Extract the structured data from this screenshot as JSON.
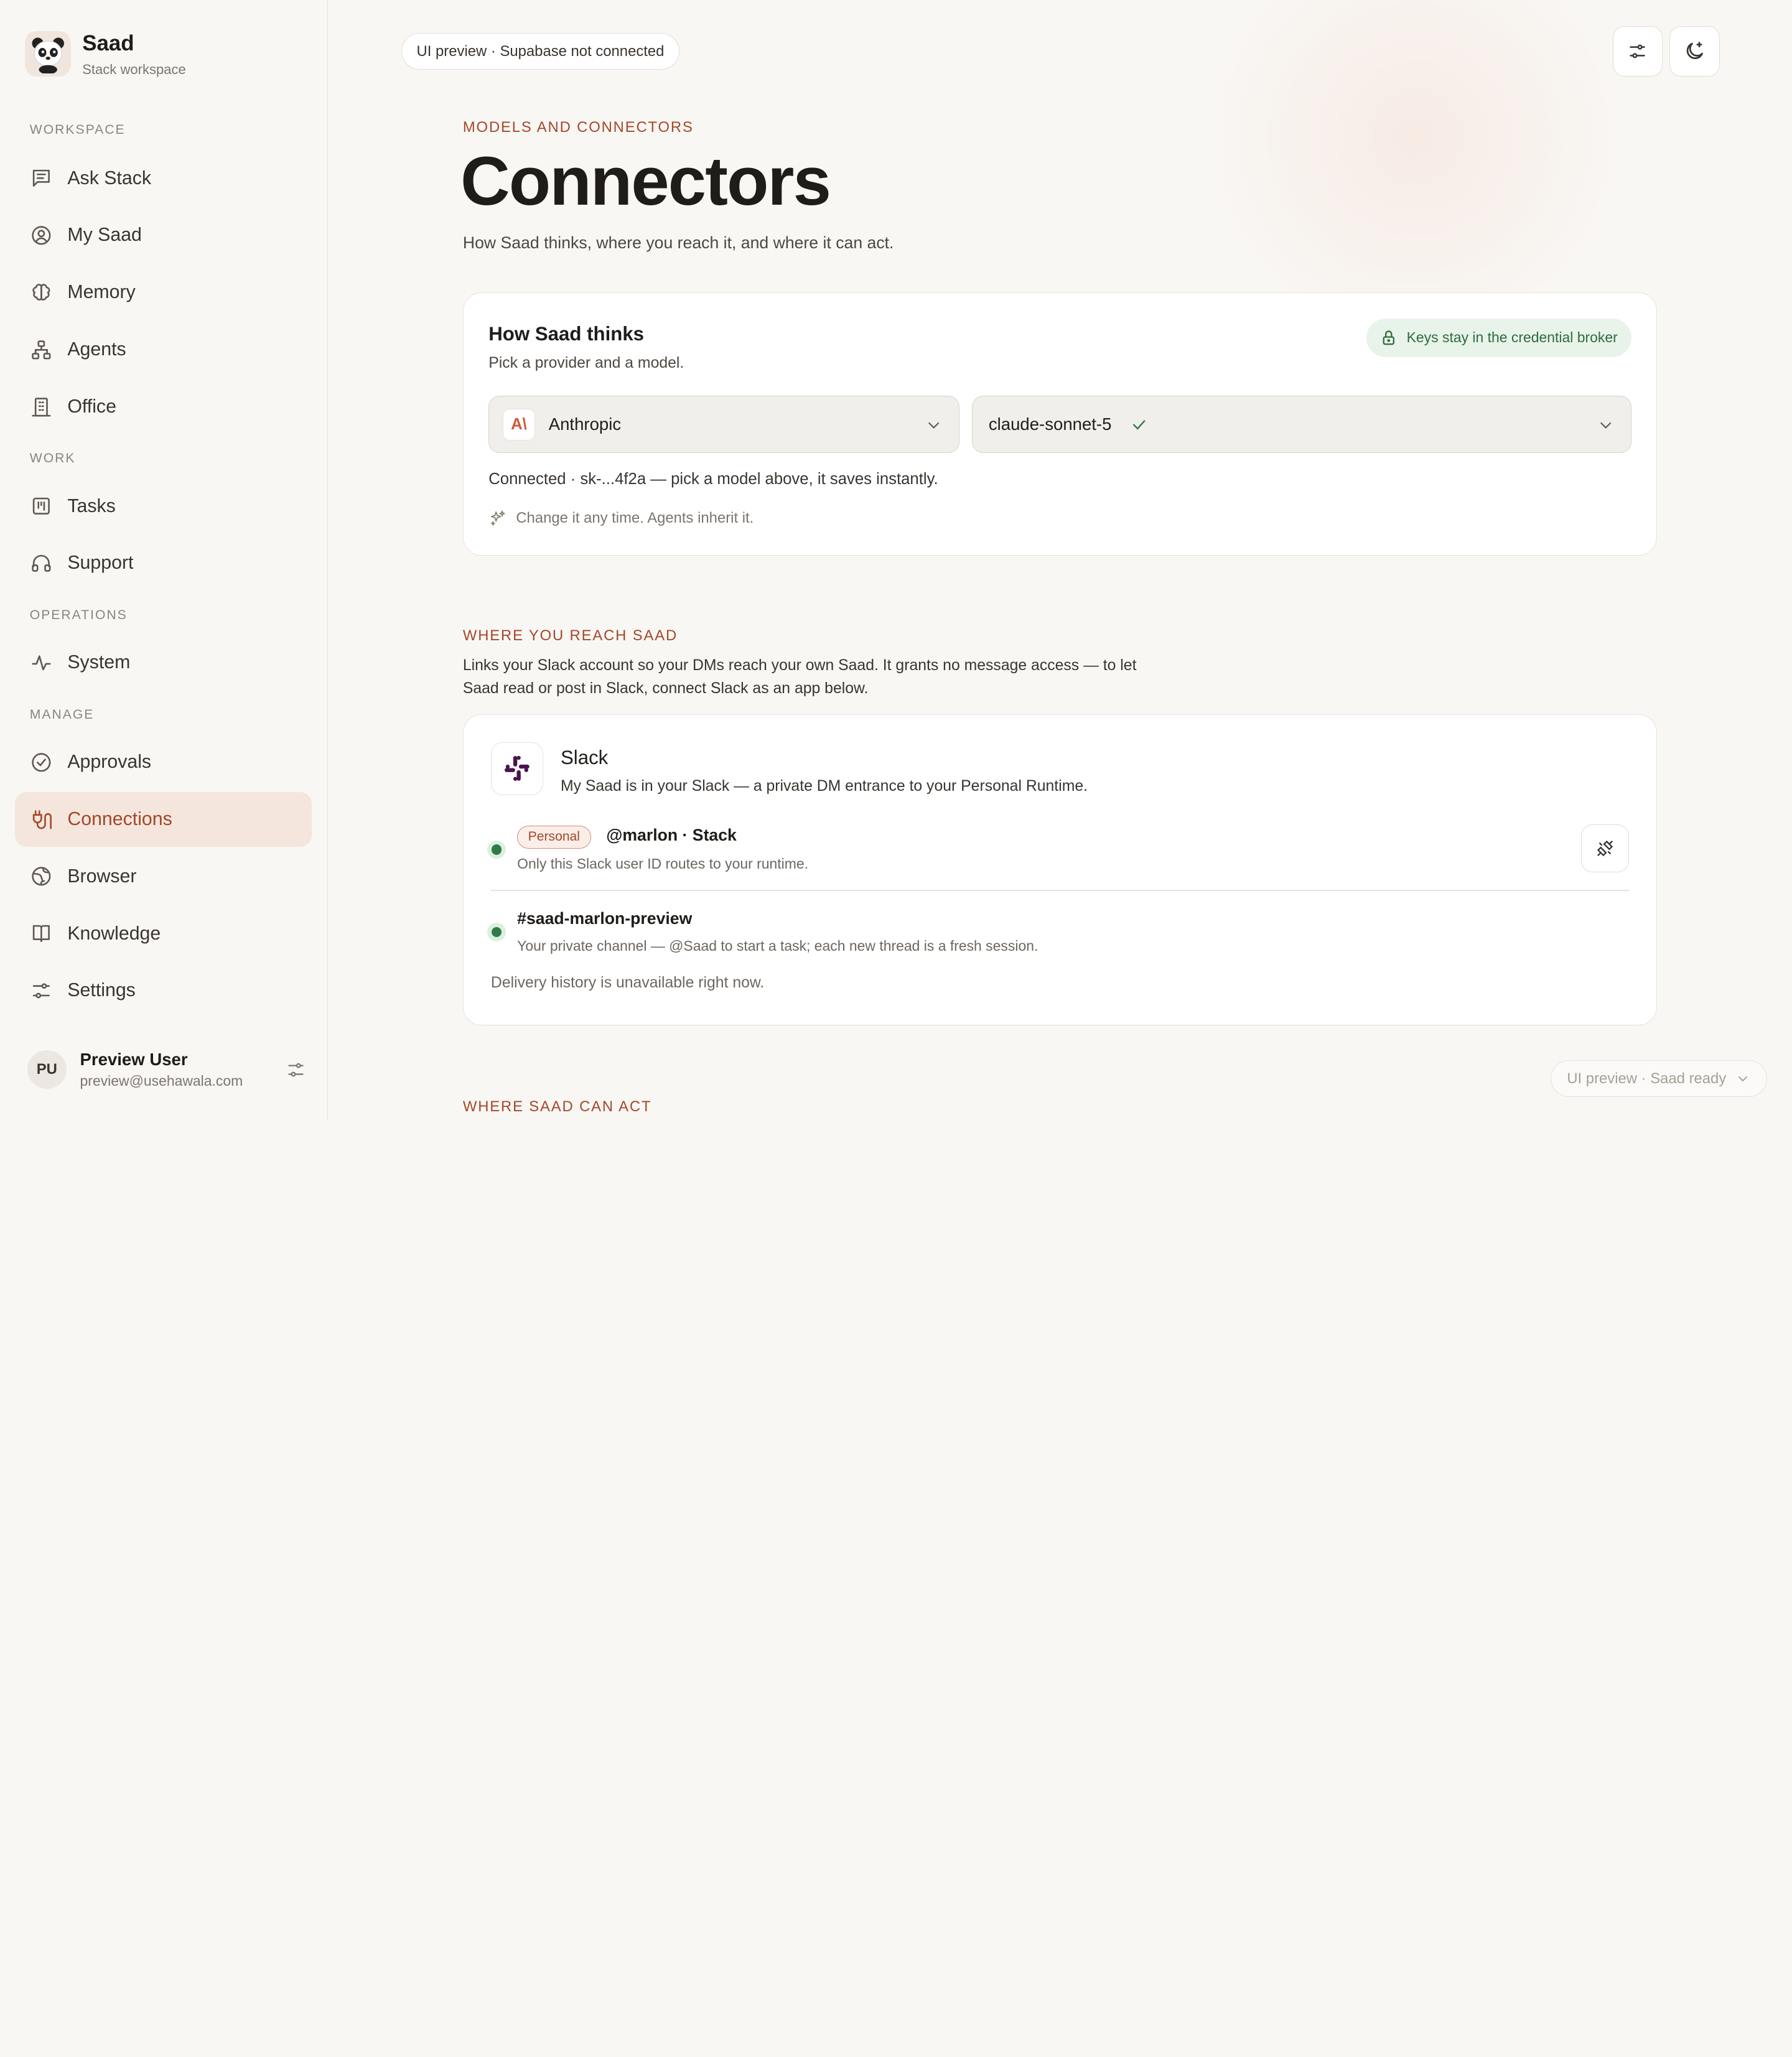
{
  "brand": {
    "name": "Saad",
    "subtitle": "Stack workspace"
  },
  "sidebar": {
    "sections": {
      "workspace": "WORKSPACE",
      "work": "WORK",
      "operations": "OPERATIONS",
      "manage": "MANAGE"
    },
    "items": [
      {
        "label": "Ask Stack",
        "icon": "message-square-icon"
      },
      {
        "label": "My Saad",
        "icon": "user-circle-icon"
      },
      {
        "label": "Memory",
        "icon": "brain-icon"
      },
      {
        "label": "Agents",
        "icon": "network-icon"
      },
      {
        "label": "Office",
        "icon": "building-icon"
      },
      {
        "label": "Tasks",
        "icon": "kanban-icon"
      },
      {
        "label": "Support",
        "icon": "headphones-icon"
      },
      {
        "label": "System",
        "icon": "activity-icon"
      },
      {
        "label": "Approvals",
        "icon": "check-circle-icon"
      },
      {
        "label": "Connections",
        "icon": "plug-icon",
        "active": true
      },
      {
        "label": "Browser",
        "icon": "globe-icon"
      },
      {
        "label": "Knowledge",
        "icon": "book-icon"
      },
      {
        "label": "Settings",
        "icon": "sliders-icon"
      }
    ],
    "user": {
      "initials": "PU",
      "name": "Preview User",
      "email": "preview@usehawala.com"
    }
  },
  "header": {
    "preview_pill": "UI preview · Supabase not connected"
  },
  "page": {
    "eyebrow": "MODELS AND CONNECTORS",
    "title": "Connectors",
    "subtitle": "How Saad thinks, where you reach it, and where it can act."
  },
  "thinks_card": {
    "title": "How Saad thinks",
    "subtitle": "Pick a provider and a model.",
    "badge": "Keys stay in the credential broker",
    "provider": "Anthropic",
    "provider_logo": "A\\",
    "model": "claude-sonnet-5",
    "connected_text": "Connected · sk-...4f2a — pick a model above, it saves instantly.",
    "hint": "Change it any time. Agents inherit it."
  },
  "reach_section": {
    "eyebrow": "WHERE YOU REACH SAAD",
    "description": "Links your Slack account so your DMs reach your own Saad. It grants no message access — to let Saad read or post in Slack, connect Slack as an app below."
  },
  "slack_card": {
    "title": "Slack",
    "subtitle": "My Saad is in your Slack — a private DM entrance to your Personal Runtime.",
    "personal_badge": "Personal",
    "handle": "@marlon · Stack",
    "handle_sub": "Only this Slack user ID routes to your runtime.",
    "channel": "#saad-marlon-preview",
    "channel_sub": "Your private channel — @Saad to start a task; each new thread is a fresh session.",
    "delivery": "Delivery history is unavailable right now."
  },
  "act_section": {
    "eyebrow": "WHERE SAAD CAN ACT"
  },
  "status_pill": "UI preview · Saad ready",
  "colors": {
    "accent": "#a4472a",
    "active_bg": "#f4e6dd",
    "success": "#2f7b46",
    "background": "#f9f7f4"
  }
}
